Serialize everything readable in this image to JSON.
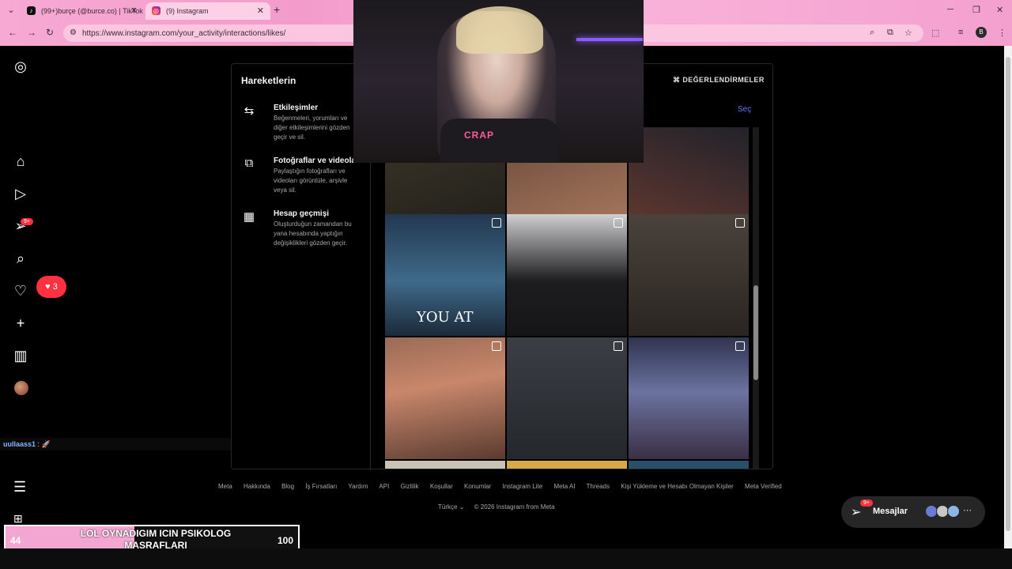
{
  "browser": {
    "tabs": [
      {
        "label": "(99+)burçe (@burce.co) | TikTok",
        "favicon": "tiktok-icon"
      },
      {
        "label": "(9) Instagram",
        "favicon": "instagram-icon"
      }
    ],
    "url": "https://www.instagram.com/your_activity/interactions/likes/",
    "profile_initial": "B"
  },
  "sidebar": {
    "notifications_badge": "9+",
    "notification_pill_count": "3",
    "icons": [
      "instagram-logo-icon",
      "home-icon",
      "reels-icon",
      "messages-icon",
      "search-icon",
      "heart-icon",
      "create-icon",
      "dashboard-icon",
      "profile-avatar",
      "more-icon",
      "apps-icon"
    ]
  },
  "panel": {
    "title": "Hareketlerin",
    "ratings_label": "DEĞERLENDİRMELER",
    "select_label": "Seç",
    "menu": [
      {
        "title": "Etkileşimler",
        "desc": "Beğenmeleri, yorumları ve diğer etkileşimlerini gözden geçir ve sil.",
        "icon": "arrows-swap-icon"
      },
      {
        "title": "Fotoğraflar ve videolar",
        "desc": "Paylaştığın fotoğrafları ve videoları görüntüle, arşivle veya sil.",
        "icon": "photo-video-icon"
      },
      {
        "title": "Hesap geçmişi",
        "desc": "Oluşturduğun zamandan bu yana hesabında yaptığın değişiklikleri gözden geçir.",
        "icon": "calendar-icon"
      }
    ],
    "grid_caption": "YOU AT"
  },
  "stream": {
    "shirt_text": "CRAP"
  },
  "chat": {
    "user": "uullaass1",
    "separator": ":"
  },
  "footer": {
    "links": [
      "Meta",
      "Hakkında",
      "Blog",
      "İş Fırsatları",
      "Yardım",
      "API",
      "Gizlilik",
      "Koşullar",
      "Konumlar",
      "Instagram Lite",
      "Meta AI",
      "Threads",
      "Kişi Yükleme ve Hesabı Olmayan Kişiler",
      "Meta Verified"
    ],
    "language": "Türkçe",
    "copyright": "© 2026 Instagram from Meta"
  },
  "messages": {
    "label": "Mesajlar",
    "badge": "9+"
  },
  "progress": {
    "start": "44",
    "end": "100",
    "text": "LOL OYNADIGIM ICIN PSIKOLOG MASRAFLARI",
    "fraction": 0.44
  }
}
